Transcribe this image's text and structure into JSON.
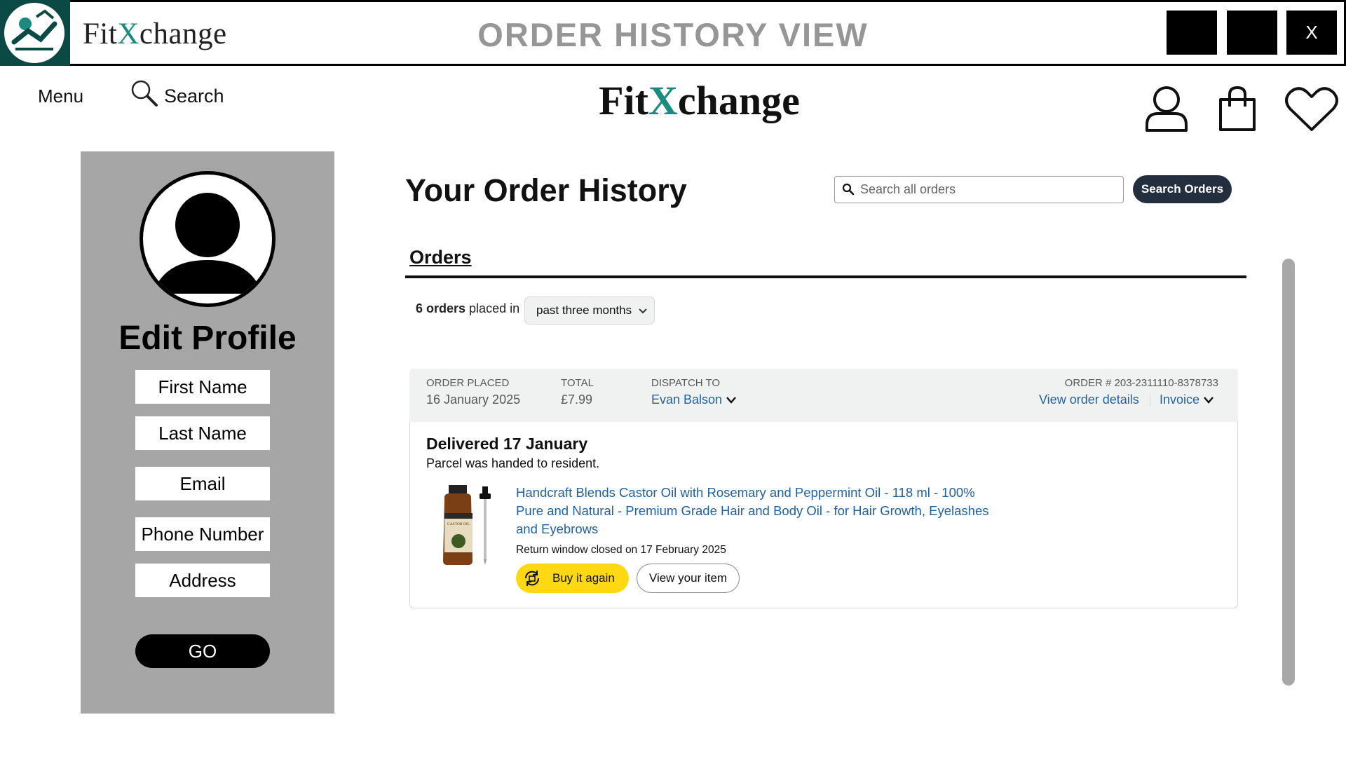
{
  "window": {
    "brand_prefix": "Fit",
    "brand_x": "X",
    "brand_suffix": "change",
    "title": "ORDER HISTORY VIEW",
    "close_label": "X"
  },
  "nav": {
    "menu_label": "Menu",
    "search_label": "Search",
    "brand_prefix": "Fit",
    "brand_x": "X",
    "brand_suffix": "change"
  },
  "profile": {
    "title": "Edit Profile",
    "fields": [
      "First Name",
      "Last Name",
      "Email",
      "Phone Number",
      "Address"
    ],
    "go_label": "GO"
  },
  "orders_page": {
    "title": "Your Order History",
    "search_placeholder": "Search all orders",
    "search_button": "Search Orders",
    "tab": "Orders",
    "count_bold": "6 orders",
    "count_rest": " placed in",
    "range": "past three months"
  },
  "order": {
    "placed_label": "ORDER PLACED",
    "placed_value": "16 January 2025",
    "total_label": "TOTAL",
    "total_value": "£7.99",
    "dispatch_label": "DISPATCH TO",
    "dispatch_value": "Evan Balson",
    "order_number": "ORDER # 203-2311110-8378733",
    "details_link": "View order details",
    "invoice_link": "Invoice",
    "status": "Delivered 17 January",
    "status_note": "Parcel was handed to resident.",
    "product_title": "Handcraft Blends Castor Oil with Rosemary and Peppermint Oil - 118 ml - 100% Pure and Natural - Premium Grade Hair and Body Oil - for Hair Growth, Eyelashes and Eyebrows",
    "return_note": "Return window closed on 17 February 2025",
    "buy_again": "Buy it again",
    "view_item": "View your item",
    "bottle_label": "CASTOR OIL"
  },
  "colors": {
    "brand_teal": "#1b8b80",
    "link_blue": "#2162a1",
    "buy_yellow": "#ffd814",
    "sidebar_gray": "#a6a6a6",
    "title_gray": "#969696"
  },
  "icons": [
    "app-logo-icon",
    "search-icon",
    "user-icon",
    "shopping-bag-icon",
    "heart-icon",
    "chevron-down-icon",
    "reorder-icon"
  ]
}
